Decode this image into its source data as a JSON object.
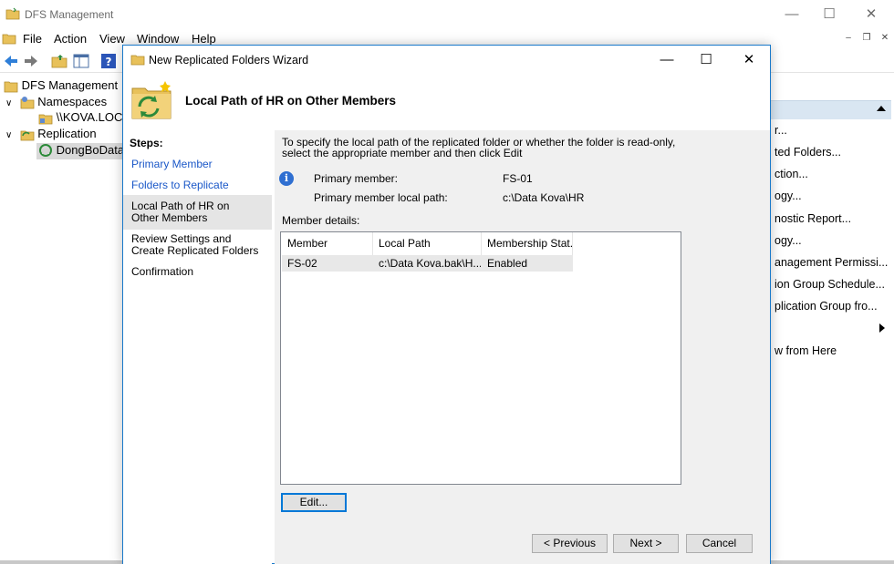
{
  "main_window": {
    "title": "DFS Management",
    "menu": [
      "File",
      "Action",
      "View",
      "Window",
      "Help"
    ]
  },
  "tree": {
    "root": "DFS Management",
    "namespaces": "Namespaces",
    "namespace_item": "\\\\KOVA.LOCAL",
    "replication": "Replication",
    "replication_item": "DongBoData"
  },
  "actions_pane": {
    "items": [
      "r...",
      "ted Folders...",
      "ction...",
      "ogy...",
      "nostic Report...",
      "ogy...",
      "anagement Permissi...",
      "ion Group Schedule...",
      "plication Group fro...",
      "w from Here"
    ]
  },
  "wizard": {
    "title": "New Replicated Folders Wizard",
    "heading": "Local Path of HR on Other Members",
    "steps_title": "Steps:",
    "steps": [
      "Primary Member",
      "Folders to Replicate",
      "Local Path of HR on Other Members",
      "Review Settings and Create Replicated Folders",
      "Confirmation"
    ],
    "instructions_line1": "To specify the local path of the replicated folder or whether the folder is read-only,",
    "instructions_line2": "select the appropriate member and then click Edit",
    "primary_member_label": "Primary member:",
    "primary_member_value": "FS-01",
    "primary_path_label": "Primary member local path:",
    "primary_path_value": "c:\\Data Kova\\HR",
    "member_details_label": "Member details:",
    "columns": [
      "Member",
      "Local Path",
      "Membership Stat..."
    ],
    "rows": [
      {
        "member": "FS-02",
        "local_path": "c:\\Data Kova.bak\\H...",
        "status": "Enabled"
      }
    ],
    "edit_button": "Edit...",
    "previous_button": "< Previous",
    "next_button": "Next >",
    "cancel_button": "Cancel"
  },
  "colors": {
    "accent_border": "#1979ca",
    "link": "#1b58c8",
    "focus_border": "#0078d7"
  }
}
